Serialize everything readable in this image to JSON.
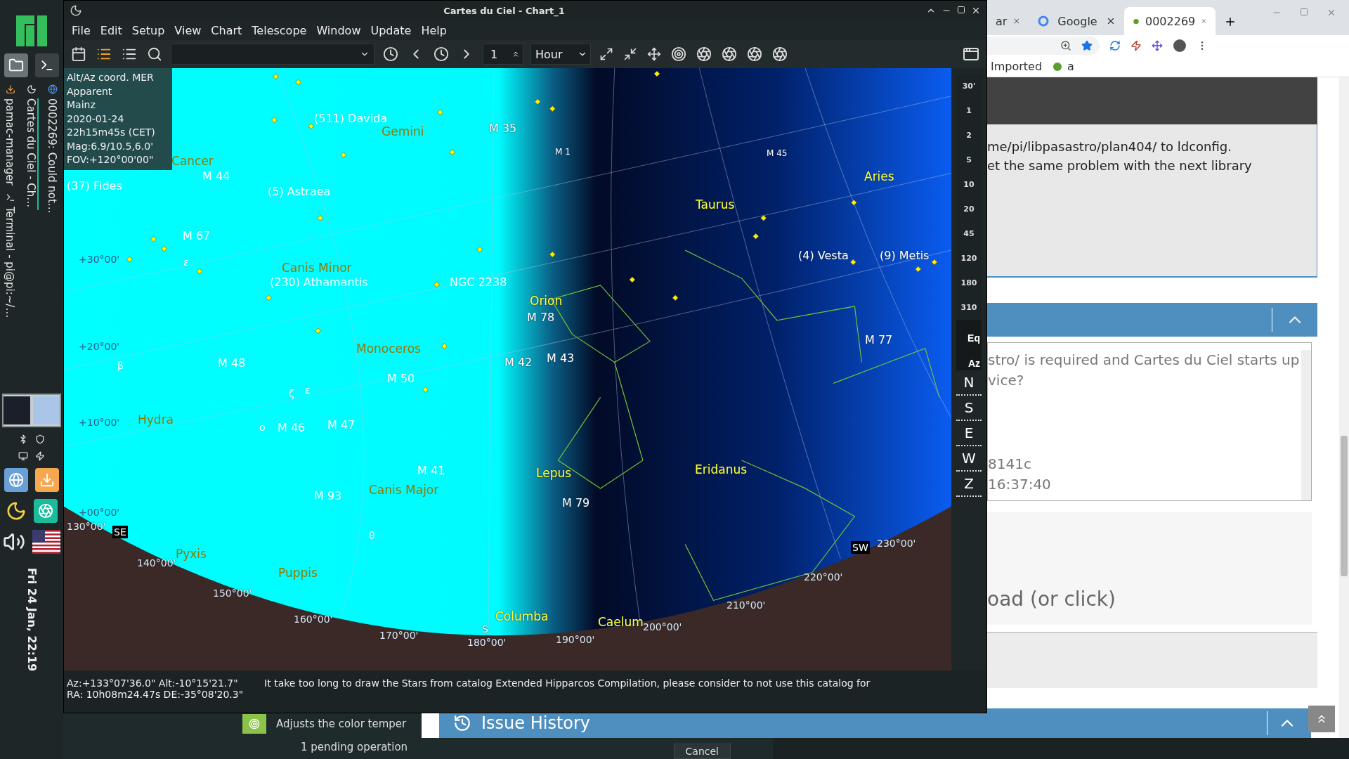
{
  "taskbar": {
    "tasks": [
      {
        "label": "pamac-manager",
        "selected": false
      },
      {
        "label": "Cartes du Ciel - Ch…",
        "selected": true
      },
      {
        "label": "0002269: Could not…",
        "selected": false
      },
      {
        "label": "Terminal - pi@pi:~/…",
        "selected": false
      }
    ],
    "clock": "Fri 24 Jan, 22:19"
  },
  "chart_window": {
    "title": "Cartes du Ciel - Chart_1",
    "menu": [
      "File",
      "Edit",
      "Setup",
      "View",
      "Chart",
      "Telescope",
      "Window",
      "Update",
      "Help"
    ],
    "toolbar": {
      "step": "1",
      "unit": "Hour"
    },
    "info_box": [
      "Alt/Az coord. MER",
      "Apparent",
      "Mainz",
      "2020-01-24",
      "22h15m45s (CET)",
      "Mag:6.9/10.5,6.0'",
      "FOV:+120°00'00\""
    ],
    "sky_labels": [
      {
        "text": "(511) Davida",
        "kind": "object"
      },
      {
        "text": "Gemini",
        "kind": "constellation"
      },
      {
        "text": "M 35",
        "kind": "object"
      },
      {
        "text": "M 1",
        "kind": "small"
      },
      {
        "text": "M 45",
        "kind": "small"
      },
      {
        "text": "Cancer",
        "kind": "constellation"
      },
      {
        "text": "(37) Fides",
        "kind": "object"
      },
      {
        "text": "M 44",
        "kind": "object"
      },
      {
        "text": "(5) Astraea",
        "kind": "object"
      },
      {
        "text": "Aries",
        "kind": "constellation"
      },
      {
        "text": "Taurus",
        "kind": "constellation"
      },
      {
        "text": "M 67",
        "kind": "object"
      },
      {
        "text": "+30°00'",
        "kind": "grid"
      },
      {
        "text": "ε",
        "kind": "star"
      },
      {
        "text": "(4) Vesta",
        "kind": "object"
      },
      {
        "text": "(9) Metis",
        "kind": "object"
      },
      {
        "text": "Canis Minor",
        "kind": "constellation"
      },
      {
        "text": "(230) Athamantis",
        "kind": "object"
      },
      {
        "text": "NGC 2238",
        "kind": "object"
      },
      {
        "text": "Orion",
        "kind": "constellation"
      },
      {
        "text": "M 78",
        "kind": "object"
      },
      {
        "text": "+20°00'",
        "kind": "grid"
      },
      {
        "text": "Monoceros",
        "kind": "constellation"
      },
      {
        "text": "M 77",
        "kind": "object"
      },
      {
        "text": "β",
        "kind": "star"
      },
      {
        "text": "M 48",
        "kind": "object"
      },
      {
        "text": "M 42",
        "kind": "object"
      },
      {
        "text": "M 43",
        "kind": "object"
      },
      {
        "text": "M 50",
        "kind": "object"
      },
      {
        "text": "ζ",
        "kind": "star"
      },
      {
        "text": "ε",
        "kind": "star"
      },
      {
        "text": "+10°00'",
        "kind": "grid"
      },
      {
        "text": "Hydra",
        "kind": "constellation"
      },
      {
        "text": "ο",
        "kind": "star"
      },
      {
        "text": "M 46",
        "kind": "object"
      },
      {
        "text": "M 47",
        "kind": "object"
      },
      {
        "text": "M 41",
        "kind": "object"
      },
      {
        "text": "Lepus",
        "kind": "constellation"
      },
      {
        "text": "Eridanus",
        "kind": "constellation"
      },
      {
        "text": "M 93",
        "kind": "object"
      },
      {
        "text": "Canis Major",
        "kind": "constellation"
      },
      {
        "text": "M 79",
        "kind": "object"
      },
      {
        "text": "+00°00'",
        "kind": "grid"
      },
      {
        "text": "130°00'",
        "kind": "grid"
      },
      {
        "text": "SE",
        "kind": "compass"
      },
      {
        "text": "θ",
        "kind": "star"
      },
      {
        "text": "SW",
        "kind": "compass"
      },
      {
        "text": "230°00'",
        "kind": "grid"
      },
      {
        "text": "140°00'",
        "kind": "grid"
      },
      {
        "text": "Pyxis",
        "kind": "constellation"
      },
      {
        "text": "Puppis",
        "kind": "constellation"
      },
      {
        "text": "220°00'",
        "kind": "grid"
      },
      {
        "text": "150°00'",
        "kind": "grid"
      },
      {
        "text": "210°00'",
        "kind": "grid"
      },
      {
        "text": "160°00'",
        "kind": "grid"
      },
      {
        "text": "S",
        "kind": "cardinal"
      },
      {
        "text": "Columba",
        "kind": "constellation"
      },
      {
        "text": "Caelum",
        "kind": "constellation"
      },
      {
        "text": "200°00'",
        "kind": "grid"
      },
      {
        "text": "170°00'",
        "kind": "grid"
      },
      {
        "text": "180°00'",
        "kind": "grid"
      },
      {
        "text": "190°00'",
        "kind": "grid"
      }
    ],
    "scale": [
      "30'",
      "1",
      "2",
      "5",
      "10",
      "20",
      "45",
      "120",
      "180",
      "310"
    ],
    "projection_buttons": [
      "Eq",
      "Az"
    ],
    "direction_buttons": [
      "N",
      "S",
      "E",
      "W",
      "Z"
    ],
    "status": {
      "position": [
        "Az:+133°07'36.0\" Alt:-10°15'21.7\"",
        "RA: 10h08m24.47s DE:-35°08'20.3\""
      ],
      "message": "It take too long to draw the Stars from catalog Extended Hipparcos Compilation, please consider to not use this catalog for"
    }
  },
  "browser": {
    "tabs": [
      {
        "label": "ar",
        "selected": false
      },
      {
        "label": "Google",
        "selected": false
      },
      {
        "label": "0002269",
        "selected": true
      }
    ],
    "bookmarks": [
      "Imported",
      "a"
    ],
    "note_lines": [
      "me/pi/libpasastro/plan404/ to ldconfig.",
      "et the same problem with the next library"
    ],
    "textarea_lines": [
      "stro/ is required and Cartes du Ciel starts up",
      "vice?",
      "8141c",
      "16:37:40"
    ],
    "dropzone": "oad (or click)",
    "section": "Issue History"
  },
  "pamac": {
    "description": "Adjusts the color temper",
    "pending": "1 pending operation",
    "cancel": "Cancel"
  }
}
